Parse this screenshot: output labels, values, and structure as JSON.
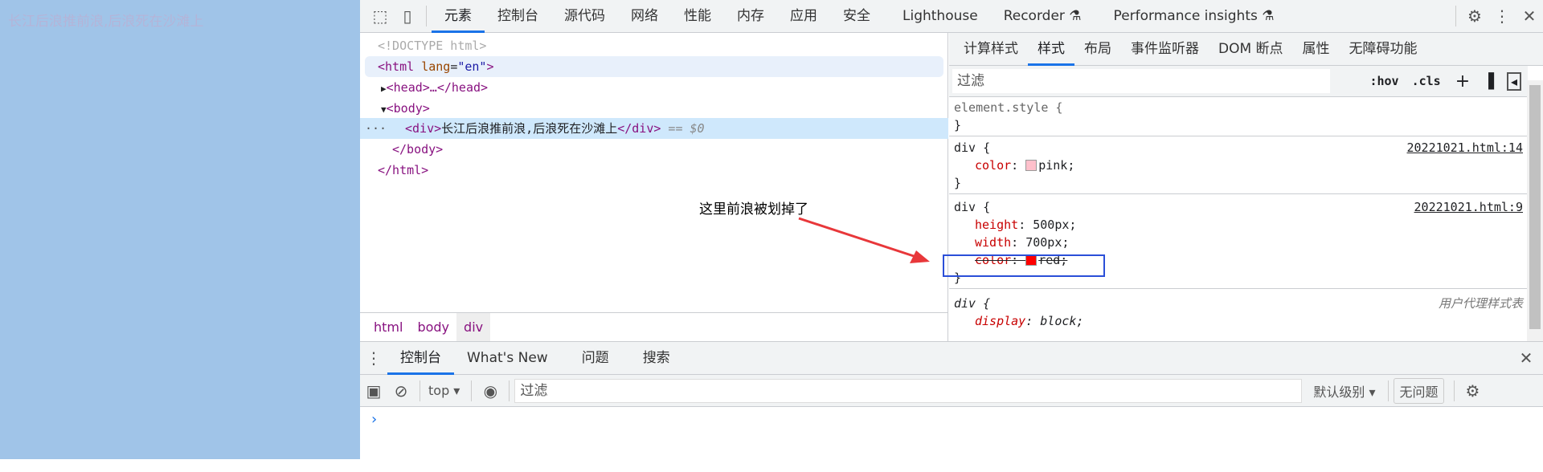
{
  "page": {
    "text": "长江后浪推前浪,后浪死在沙滩上"
  },
  "topbar": {
    "tabs": [
      "元素",
      "控制台",
      "源代码",
      "网络",
      "性能",
      "内存",
      "应用",
      "安全",
      "Lighthouse",
      "Recorder",
      "Performance insights"
    ],
    "active": "元素"
  },
  "elements": {
    "lines": [
      "<!DOCTYPE html>",
      "<html",
      "lang",
      "\"en\"",
      ">",
      "<head>…</head>",
      "<body>",
      "<div>",
      "长江后浪推前浪,后浪死在沙滩上",
      "</div>",
      "== $0",
      "</body>",
      "</html>"
    ]
  },
  "breadcrumb": [
    "html",
    "body",
    "div"
  ],
  "styles": {
    "tabs": [
      "计算样式",
      "样式",
      "布局",
      "事件监听器",
      "DOM 断点",
      "属性",
      "无障碍功能"
    ],
    "active": "样式",
    "filter_placeholder": "过滤",
    "hov": ":hov",
    "cls": ".cls",
    "rules": [
      {
        "selector": "element.style {",
        "close": "}"
      },
      {
        "selector": "div {",
        "source": "20221021.html:14",
        "props": [
          {
            "name": "color",
            "value": "pink;",
            "swatch": "#ffc0cb"
          }
        ],
        "close": "}"
      },
      {
        "selector": "div {",
        "source": "20221021.html:9",
        "props": [
          {
            "name": "height",
            "value": "500px;"
          },
          {
            "name": "width",
            "value": "700px;"
          },
          {
            "name": "color",
            "value": "red;",
            "swatch": "#ff0000",
            "struck": true
          }
        ],
        "close": "}"
      },
      {
        "selector": "div {",
        "source": "用户代理样式表",
        "props": [
          {
            "name": "display",
            "value": "block;"
          }
        ]
      }
    ]
  },
  "annotation": {
    "text": "这里前浪被划掉了",
    "arrow_color": "#e8373a",
    "box_color": "#2b4fd8"
  },
  "drawer": {
    "tabs": [
      "控制台",
      "What's New",
      "问题",
      "搜索"
    ],
    "active": "控制台",
    "context": "top",
    "filter_placeholder": "过滤",
    "level": "默认级别",
    "issues": "无问题",
    "prompt": "›"
  }
}
